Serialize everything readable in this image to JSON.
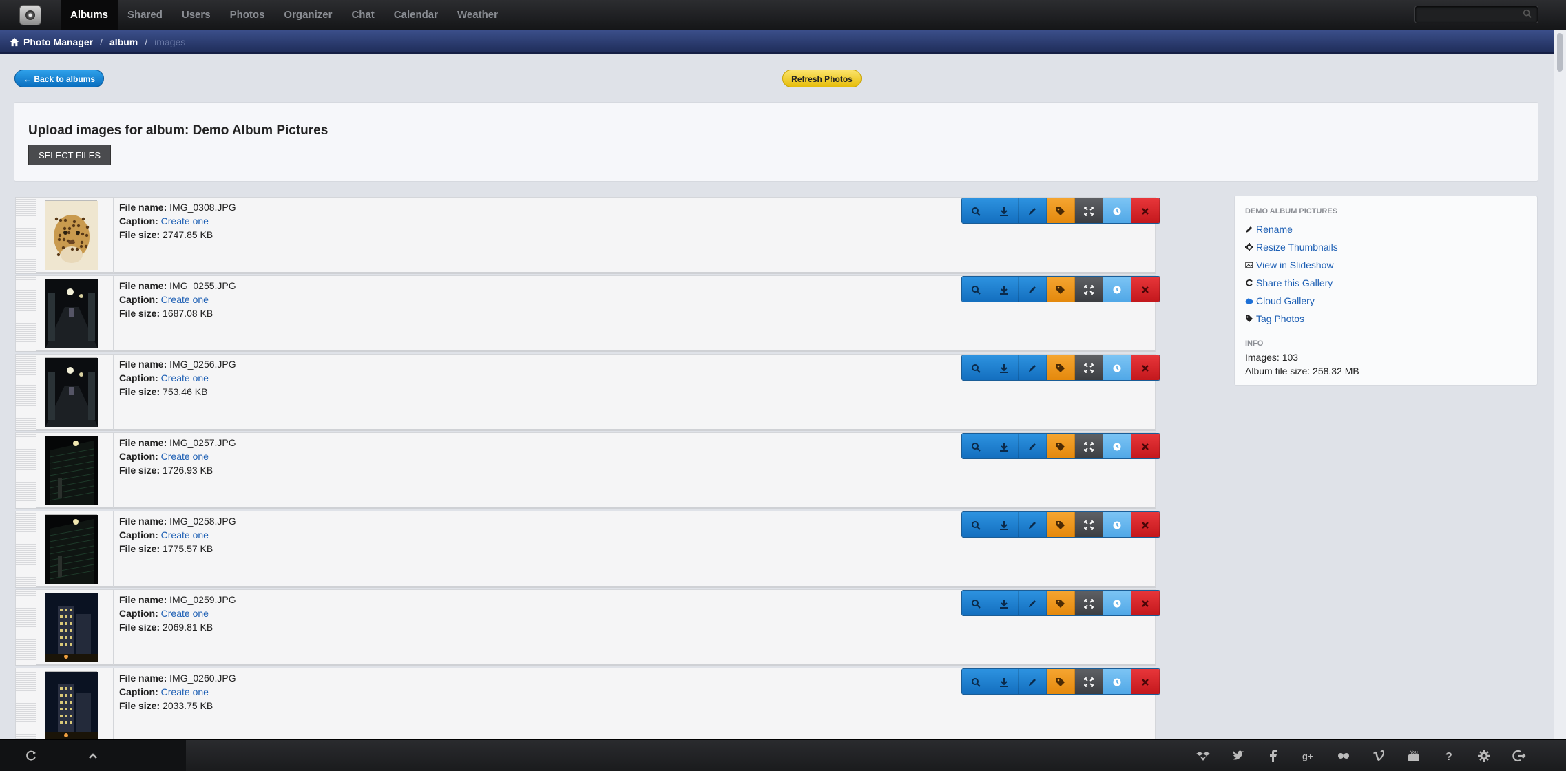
{
  "nav": {
    "items": [
      {
        "label": "Albums",
        "active": true
      },
      {
        "label": "Shared"
      },
      {
        "label": "Users"
      },
      {
        "label": "Photos"
      },
      {
        "label": "Organizer"
      },
      {
        "label": "Chat"
      },
      {
        "label": "Calendar"
      },
      {
        "label": "Weather"
      }
    ],
    "search_placeholder": ""
  },
  "breadcrumb": {
    "home": "Photo Manager",
    "level1": "album",
    "current": "images"
  },
  "toolbar": {
    "back_label": "← Back to albums",
    "refresh_label": "Refresh Photos"
  },
  "upload": {
    "title": "Upload images for album: Demo Album Pictures",
    "select_label": "SELECT FILES"
  },
  "labels": {
    "file_name": "File name:",
    "caption": "Caption:",
    "file_size": "File size:",
    "create_one": "Create one"
  },
  "images": [
    {
      "file_name": "IMG_0308.JPG",
      "file_size": "2747.85 KB",
      "thumb": "leopard"
    },
    {
      "file_name": "IMG_0255.JPG",
      "file_size": "1687.08 KB",
      "thumb": "night-corridor"
    },
    {
      "file_name": "IMG_0256.JPG",
      "file_size": "753.46 KB",
      "thumb": "night-corridor"
    },
    {
      "file_name": "IMG_0257.JPG",
      "file_size": "1726.93 KB",
      "thumb": "night-stairs"
    },
    {
      "file_name": "IMG_0258.JPG",
      "file_size": "1775.57 KB",
      "thumb": "night-stairs"
    },
    {
      "file_name": "IMG_0259.JPG",
      "file_size": "2069.81 KB",
      "thumb": "night-building"
    },
    {
      "file_name": "IMG_0260.JPG",
      "file_size": "2033.75 KB",
      "thumb": "night-building"
    }
  ],
  "sidebar": {
    "heading": "DEMO ALBUM PICTURES",
    "links": [
      {
        "label": "Rename",
        "icon": "pencil-icon"
      },
      {
        "label": "Resize Thumbnails",
        "icon": "gear-icon"
      },
      {
        "label": "View in Slideshow",
        "icon": "picture-icon"
      },
      {
        "label": "Share this Gallery",
        "icon": "share-icon"
      },
      {
        "label": "Cloud Gallery",
        "icon": "cloud-icon"
      },
      {
        "label": "Tag Photos",
        "icon": "tag-icon"
      }
    ],
    "info_heading": "INFO",
    "images_count": "Images: 103",
    "album_size": "Album file size: 258.32 MB"
  },
  "colors": {
    "link": "#1d5fb4",
    "action_blue": "#126dbd",
    "action_orange": "#e3870b",
    "action_red": "#c1161b"
  },
  "bottom_icons": [
    "dropbox-icon",
    "twitter-icon",
    "facebook-icon",
    "google-plus-icon",
    "flickr-icon",
    "vimeo-icon",
    "youtube-icon",
    "help-icon",
    "settings-icon",
    "logout-icon"
  ]
}
